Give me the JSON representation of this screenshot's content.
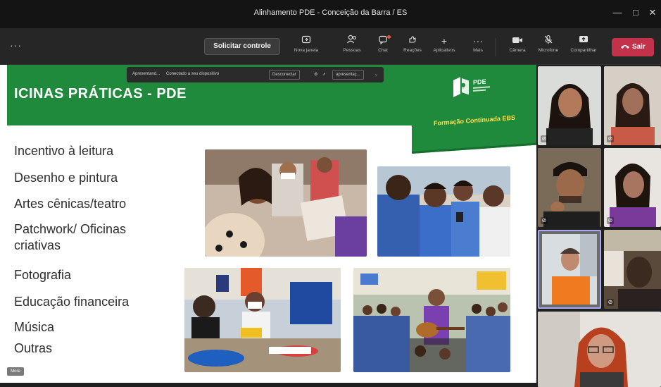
{
  "window": {
    "title": "Alinhamento PDE - Conceição da Barra / ES",
    "controls": [
      "minimize-icon",
      "maximize-icon",
      "close-icon"
    ]
  },
  "toolbar": {
    "request_control": "Solicitar controle",
    "tools": [
      {
        "icon": "new-window-icon",
        "label": "Nova janela"
      },
      {
        "icon": "people-icon",
        "label": "Pessoas"
      },
      {
        "icon": "chat-icon",
        "label": "Chat"
      },
      {
        "icon": "reactions-icon",
        "label": "Reações"
      },
      {
        "icon": "apps-icon",
        "label": "Aplicativos"
      },
      {
        "icon": "more-icon",
        "label": "Mais"
      },
      {
        "icon": "camera-icon",
        "label": "Câmera"
      },
      {
        "icon": "microphone-off-icon",
        "label": "Microfone"
      },
      {
        "icon": "share-icon",
        "label": "Compartilhar"
      }
    ],
    "leave": "Sair",
    "leave_color": "#c4314b"
  },
  "share_bar": {
    "presenter": "Apresentand...",
    "status": "Conectado a seu dispositivo",
    "disconnect": "Desconectar",
    "presenting": "apresentaç..."
  },
  "slide": {
    "title": "ICINAS PRÁTICAS - PDE",
    "brand_color": "#1f8a3c",
    "badge_logo": "PDE",
    "badge_subtitle": "Formação Continuada EBS",
    "topics": [
      "Incentivo à leitura",
      "Desenho e pintura",
      "Artes cênicas/teatro",
      "Patchwork/ Oficinas",
      "criativas",
      "Fotografia",
      "Educação financeira",
      "Música",
      "Outras"
    ],
    "more_tag": "More"
  }
}
